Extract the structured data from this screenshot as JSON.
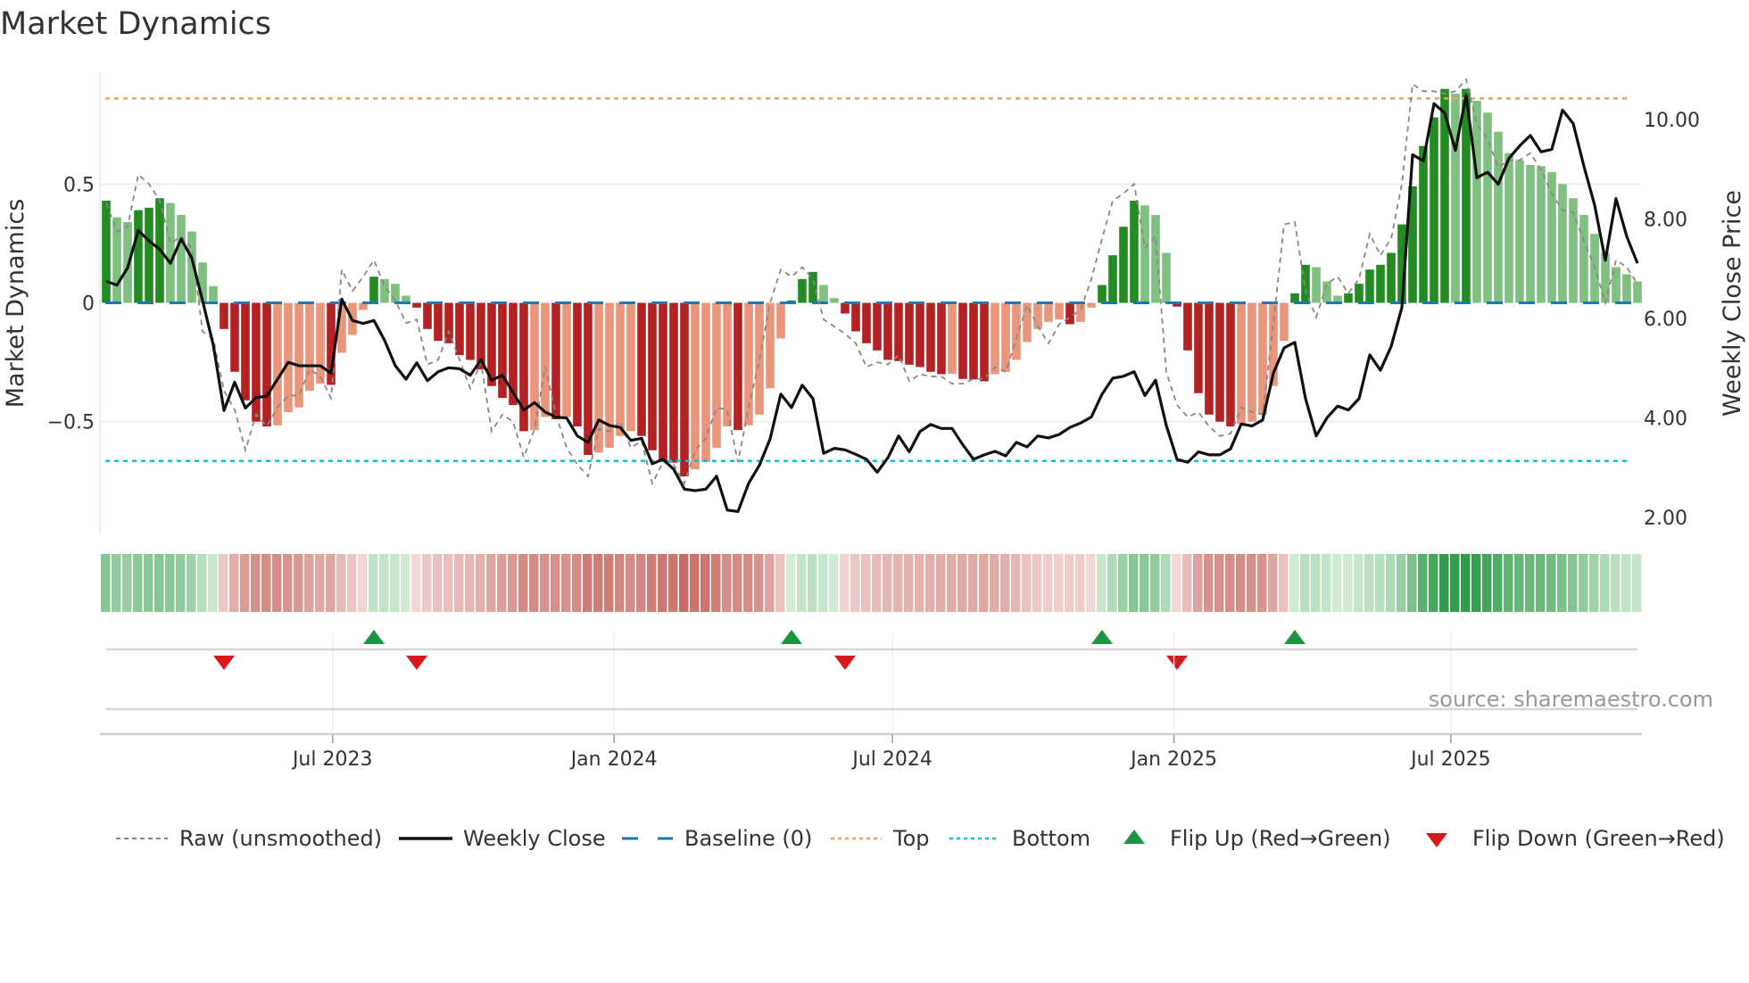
{
  "title": "Market Dynamics",
  "source": "source: sharemaestro.com",
  "legend": [
    {
      "key": "raw",
      "label": "Raw (unsmoothed)"
    },
    {
      "key": "close",
      "label": "Weekly Close"
    },
    {
      "key": "baseline",
      "label": "Baseline (0)"
    },
    {
      "key": "top",
      "label": "Top"
    },
    {
      "key": "bottom",
      "label": "Bottom"
    },
    {
      "key": "flip_up",
      "label": "Flip Up (Red→Green)"
    },
    {
      "key": "flip_down",
      "label": "Flip Down (Green→Red)"
    }
  ],
  "colors": {
    "bar_up_strong": "#228b22",
    "bar_up_weak": "#7fbf7f",
    "bar_down_strong": "#b22222",
    "bar_down_weak": "#e9967a",
    "raw": "#888888",
    "close": "#111111",
    "baseline": "#1f77b4",
    "top": "#f0a060",
    "bottom": "#17becf",
    "flip_up": "#1a9641",
    "flip_down": "#d7191c"
  },
  "chart_data": {
    "type": "bar",
    "title": "Market Dynamics",
    "ylabel": "Market Dynamics",
    "y2label": "Weekly Close Price",
    "start_date": "2023-02-03",
    "frequency": "weekly",
    "ylim": [
      -0.97,
      0.97
    ],
    "y2lim": [
      1.68,
      10.95
    ],
    "yticks": [
      {
        "v": 0.5,
        "label": "0.5"
      },
      {
        "v": 0,
        "label": "0"
      },
      {
        "v": -0.5,
        "label": "−0.5"
      }
    ],
    "y2ticks": [
      {
        "v": 10,
        "label": "10.00"
      },
      {
        "v": 8,
        "label": "8.00"
      },
      {
        "v": 6,
        "label": "6.00"
      },
      {
        "v": 4,
        "label": "4.00"
      },
      {
        "v": 2,
        "label": "2.00"
      }
    ],
    "xticks": [
      {
        "date": "2023-07-01",
        "label": "Jul 2023"
      },
      {
        "date": "2024-01-01",
        "label": "Jan 2024"
      },
      {
        "date": "2024-07-01",
        "label": "Jul 2024"
      },
      {
        "date": "2025-01-01",
        "label": "Jan 2025"
      },
      {
        "date": "2025-07-01",
        "label": "Jul 2025"
      }
    ],
    "top_level": 0.86,
    "bottom_level": -0.665,
    "baseline": 0,
    "legend_position": "bottom",
    "smoothed": [
      0.43,
      0.36,
      0.34,
      0.39,
      0.4,
      0.44,
      0.42,
      0.37,
      0.3,
      0.17,
      0.07,
      -0.11,
      -0.29,
      -0.41,
      -0.5,
      -0.52,
      -0.515,
      -0.46,
      -0.44,
      -0.37,
      -0.34,
      -0.345,
      -0.21,
      -0.135,
      -0.03,
      0.11,
      0.1,
      0.08,
      0.03,
      -0.02,
      -0.11,
      -0.16,
      -0.17,
      -0.22,
      -0.24,
      -0.28,
      -0.35,
      -0.4,
      -0.43,
      -0.54,
      -0.535,
      -0.48,
      -0.49,
      -0.48,
      -0.52,
      -0.64,
      -0.63,
      -0.61,
      -0.56,
      -0.54,
      -0.56,
      -0.62,
      -0.67,
      -0.672,
      -0.73,
      -0.7,
      -0.67,
      -0.61,
      -0.52,
      -0.535,
      -0.515,
      -0.47,
      -0.36,
      -0.15,
      0.01,
      0.1,
      0.13,
      0.075,
      0.02,
      -0.045,
      -0.12,
      -0.17,
      -0.2,
      -0.24,
      -0.245,
      -0.26,
      -0.27,
      -0.29,
      -0.3,
      -0.298,
      -0.32,
      -0.322,
      -0.33,
      -0.3,
      -0.29,
      -0.24,
      -0.165,
      -0.11,
      -0.08,
      -0.07,
      -0.09,
      -0.08,
      -0.02,
      0.075,
      0.2,
      0.32,
      0.43,
      0.41,
      0.37,
      0.21,
      -0.016,
      -0.2,
      -0.38,
      -0.47,
      -0.5,
      -0.52,
      -0.51,
      -0.5,
      -0.47,
      -0.35,
      -0.16,
      0.04,
      0.16,
      0.15,
      0.09,
      0.03,
      0.04,
      0.08,
      0.14,
      0.16,
      0.21,
      0.33,
      0.49,
      0.66,
      0.78,
      0.9,
      0.88,
      0.9,
      0.85,
      0.8,
      0.72,
      0.63,
      0.6,
      0.58,
      0.575,
      0.55,
      0.5,
      0.44,
      0.37,
      0.29,
      0.21,
      0.15,
      0.12,
      0.09
    ],
    "raw": [
      0.42,
      0.3,
      0.32,
      0.54,
      0.5,
      0.43,
      0.25,
      0.28,
      0.23,
      -0.12,
      -0.15,
      -0.37,
      -0.45,
      -0.62,
      -0.47,
      -0.52,
      -0.44,
      -0.39,
      -0.39,
      -0.28,
      -0.31,
      -0.4,
      0.14,
      0.05,
      0.11,
      0.18,
      0.07,
      0.01,
      -0.085,
      -0.07,
      -0.26,
      -0.24,
      -0.12,
      -0.24,
      -0.36,
      -0.25,
      -0.54,
      -0.47,
      -0.5,
      -0.65,
      -0.53,
      -0.27,
      -0.47,
      -0.61,
      -0.68,
      -0.73,
      -0.53,
      -0.54,
      -0.5,
      -0.61,
      -0.58,
      -0.76,
      -0.67,
      -0.68,
      -0.76,
      -0.62,
      -0.57,
      -0.44,
      -0.45,
      -0.67,
      -0.44,
      -0.24,
      0.0,
      0.14,
      0.11,
      0.15,
      0.1,
      -0.07,
      -0.1,
      -0.13,
      -0.17,
      -0.27,
      -0.25,
      -0.26,
      -0.22,
      -0.33,
      -0.3,
      -0.31,
      -0.31,
      -0.34,
      -0.34,
      -0.32,
      -0.32,
      -0.27,
      -0.29,
      -0.15,
      -0.01,
      -0.1,
      -0.17,
      -0.09,
      -0.06,
      -0.03,
      0.1,
      0.27,
      0.43,
      0.46,
      0.5,
      0.23,
      0.28,
      -0.29,
      -0.43,
      -0.48,
      -0.46,
      -0.52,
      -0.56,
      -0.55,
      -0.44,
      -0.46,
      -0.47,
      -0.085,
      0.33,
      0.34,
      0.05,
      -0.06,
      0.08,
      0.11,
      0.04,
      0.1,
      0.29,
      0.2,
      0.27,
      0.5,
      0.92,
      0.89,
      0.89,
      0.88,
      0.89,
      0.94,
      0.75,
      0.69,
      0.57,
      0.6,
      0.6,
      0.63,
      0.56,
      0.46,
      0.39,
      0.38,
      0.26,
      0.15,
      0.0,
      0.18,
      0.15,
      0.08
    ],
    "close": [
      6.75,
      6.67,
      7.02,
      7.77,
      7.56,
      7.39,
      7.11,
      7.6,
      7.21,
      6.36,
      5.47,
      4.15,
      4.72,
      4.2,
      4.41,
      4.44,
      4.78,
      5.12,
      5.05,
      5.05,
      5.05,
      4.9,
      6.39,
      5.96,
      5.9,
      5.96,
      5.56,
      5.05,
      4.78,
      5.11,
      4.75,
      4.93,
      5.01,
      4.99,
      4.86,
      5.17,
      4.76,
      4.86,
      4.51,
      4.16,
      4.31,
      4.12,
      4.02,
      4.0,
      3.64,
      3.51,
      3.96,
      3.85,
      3.81,
      3.55,
      3.59,
      3.08,
      3.17,
      2.97,
      2.57,
      2.54,
      2.57,
      2.83,
      2.15,
      2.12,
      2.69,
      3.05,
      3.58,
      4.48,
      4.21,
      4.66,
      4.39,
      3.29,
      3.39,
      3.36,
      3.27,
      3.17,
      2.91,
      3.2,
      3.64,
      3.32,
      3.73,
      3.87,
      3.79,
      3.79,
      3.46,
      3.17,
      3.26,
      3.33,
      3.24,
      3.51,
      3.42,
      3.64,
      3.6,
      3.67,
      3.81,
      3.9,
      4.02,
      4.48,
      4.8,
      4.84,
      4.93,
      4.45,
      4.76,
      3.85,
      3.17,
      3.11,
      3.32,
      3.26,
      3.26,
      3.38,
      3.88,
      3.84,
      3.96,
      4.9,
      5.41,
      5.52,
      4.39,
      3.64,
      4.0,
      4.24,
      4.16,
      4.39,
      5.27,
      4.96,
      5.44,
      6.22,
      9.29,
      9.17,
      10.32,
      10.13,
      9.38,
      10.49,
      8.83,
      8.94,
      8.7,
      9.22,
      9.47,
      9.68,
      9.35,
      9.4,
      10.19,
      9.92,
      9.06,
      8.28,
      7.17,
      8.41,
      7.65,
      7.11
    ]
  }
}
